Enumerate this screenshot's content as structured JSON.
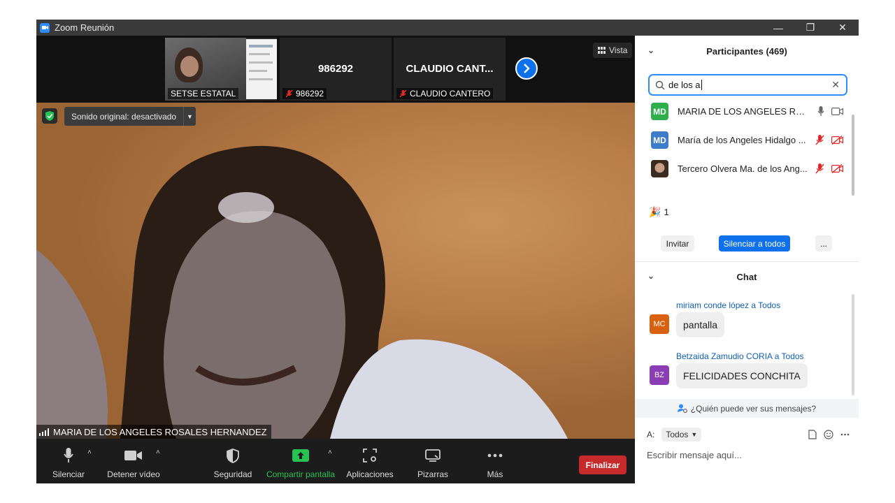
{
  "window": {
    "title": "Zoom Reunión"
  },
  "strip": {
    "thumbs": [
      {
        "name": "SETSE ESTATAL"
      },
      {
        "big": "986292",
        "name": "986292"
      },
      {
        "big": "CLAUDIO CANT...",
        "name": "CLAUDIO CANTERO"
      }
    ],
    "view_label": "Vista"
  },
  "video": {
    "sound_label": "Sonido original: desactivado",
    "speaker_name": "MARIA DE LOS ANGELES ROSALES HERNANDEZ"
  },
  "toolbar": {
    "mute": "Silenciar",
    "stop_video": "Detener vídeo",
    "security": "Seguridad",
    "share": "Compartir pantalla",
    "apps": "Aplicaciones",
    "whiteboards": "Pizarras",
    "more": "Más",
    "end": "Finalizar"
  },
  "participants": {
    "header": "Participantes (469)",
    "search_value": "de los a",
    "rows": [
      {
        "initials": "MD",
        "color": "#2fae4c",
        "name": "MARIA DE LOS ANGELES ROSA..."
      },
      {
        "initials": "MD",
        "color": "#3d7cc9",
        "name": "María de los Angeles Hidalgo ..."
      },
      {
        "initials": "",
        "color": "#5b4636",
        "name": "Tercero Olvera Ma. de los Ang..."
      }
    ],
    "reaction_count": "1",
    "invite": "Invitar",
    "mute_all": "Silenciar a todos",
    "more": "..."
  },
  "chat": {
    "header": "Chat",
    "messages": [
      {
        "initials": "MC",
        "color": "#d9600f",
        "sender": "miriam conde lópez a Todos",
        "text": "pantalla"
      },
      {
        "initials": "BZ",
        "color": "#8a3db4",
        "sender": "Betzaida Zamudio CORIA a Todos",
        "text": "FELICIDADES CONCHITA"
      }
    ],
    "who_can_see": "¿Quién puede ver sus mensajes?",
    "to_label": "A:",
    "to_value": "Todos",
    "placeholder": "Escribir mensaje aquí..."
  },
  "colors": {
    "accent": "#0e71eb",
    "share_green": "#27c252",
    "end_red": "#c72a2a"
  }
}
